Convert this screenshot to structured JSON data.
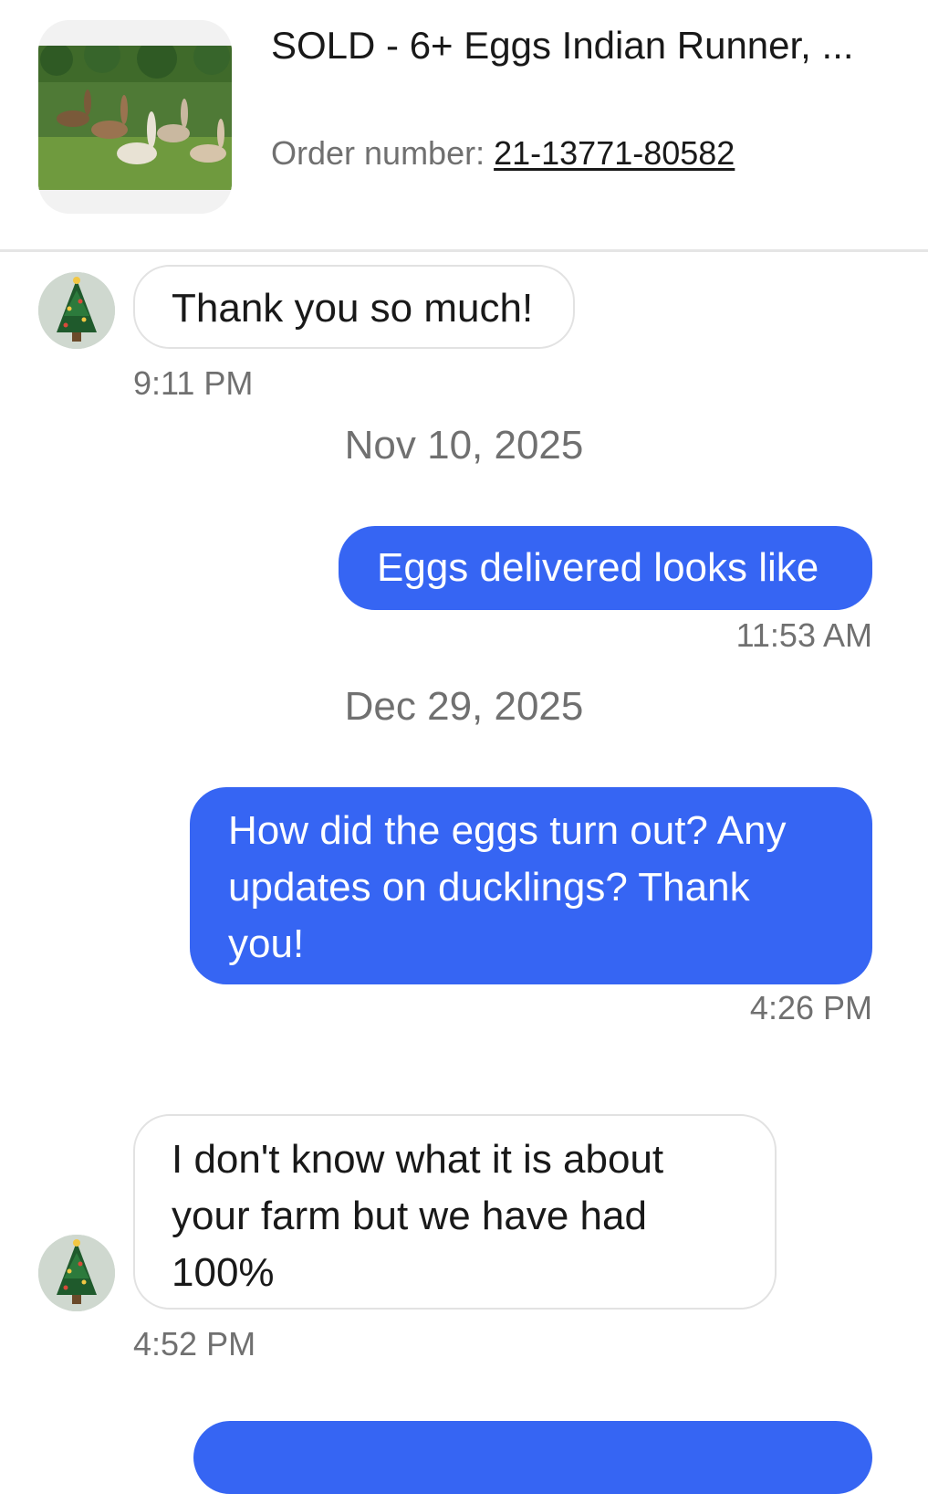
{
  "item": {
    "title": "SOLD - 6+ Eggs Indian Runner, ...",
    "order_label": "Order number: ",
    "order_number": "21-13771-80582"
  },
  "messages": [
    {
      "direction": "incoming",
      "text": "Thank you so much!",
      "time": "9:11 PM"
    },
    {
      "direction": "outgoing",
      "text": "Eggs delivered looks like",
      "time": "11:53 AM"
    },
    {
      "direction": "outgoing",
      "text": "How did the eggs turn out? Any updates on ducklings? Thank you!",
      "time": "4:26 PM"
    },
    {
      "direction": "incoming",
      "text": "I don't know what it is about your farm but we have had 100%",
      "time": "4:52 PM"
    }
  ],
  "date_separators": [
    "Nov 10, 2025",
    "Dec 29, 2025"
  ],
  "colors": {
    "outgoing_bubble": "#3665f3",
    "incoming_border": "#e2e2e2",
    "muted_text": "#707070"
  }
}
